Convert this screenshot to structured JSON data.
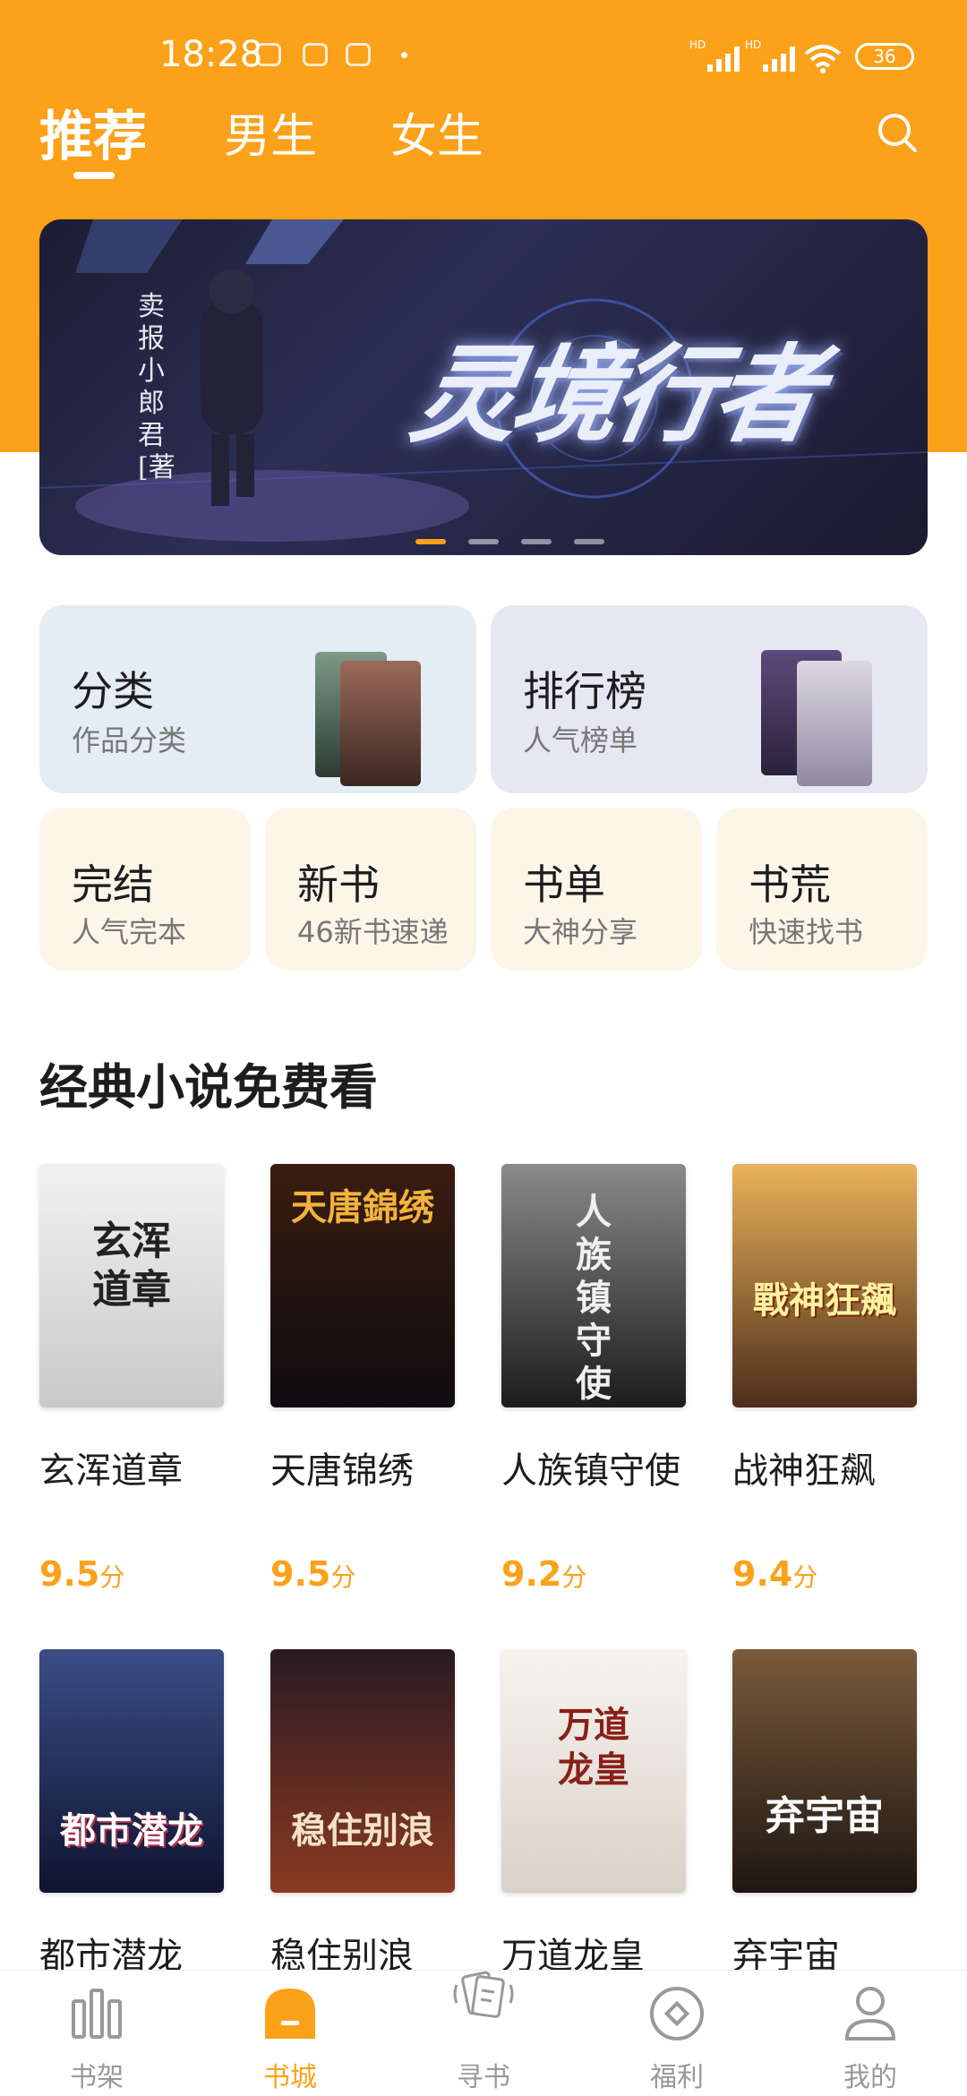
{
  "status_bar": {
    "time": "18:28",
    "battery": "36"
  },
  "tabs": [
    {
      "label": "推荐",
      "active": true
    },
    {
      "label": "男生",
      "active": false
    },
    {
      "label": "女生",
      "active": false
    }
  ],
  "banner": {
    "title": "灵境行者",
    "author": "卖报小郎君[著"
  },
  "cards": {
    "category": {
      "title": "分类",
      "sub": "作品分类"
    },
    "ranking": {
      "title": "排行榜",
      "sub": "人气榜单"
    },
    "small": [
      {
        "title": "完结",
        "sub": "人气完本"
      },
      {
        "title": "新书",
        "sub": "46新书速递"
      },
      {
        "title": "书单",
        "sub": "大神分享"
      },
      {
        "title": "书荒",
        "sub": "快速找书"
      }
    ]
  },
  "section": {
    "title": "经典小说免费看"
  },
  "books": [
    {
      "title": "玄浑道章",
      "score": "9.5",
      "unit": "分",
      "cover_text": "玄浑道章"
    },
    {
      "title": "天唐锦绣",
      "score": "9.5",
      "unit": "分",
      "cover_text": "天唐錦绣"
    },
    {
      "title": "人族镇守使",
      "score": "9.2",
      "unit": "分",
      "cover_text": "人族镇守使"
    },
    {
      "title": "战神狂飙",
      "score": "9.4",
      "unit": "分",
      "cover_text": "戰神狂飆"
    },
    {
      "title": "都市潜龙",
      "cover_text": "都市潜龙"
    },
    {
      "title": "稳住别浪",
      "cover_text": "稳住别浪"
    },
    {
      "title": "万道龙皇",
      "cover_text": "万道龙皇"
    },
    {
      "title": "弃宇宙",
      "cover_text": "弃宇宙"
    }
  ],
  "bottom_nav": [
    {
      "label": "书架",
      "icon": "bookshelf-icon",
      "active": false
    },
    {
      "label": "书城",
      "icon": "bookstore-icon",
      "active": true
    },
    {
      "label": "寻书",
      "icon": "find-book-icon",
      "active": false
    },
    {
      "label": "福利",
      "icon": "welfare-icon",
      "active": false
    },
    {
      "label": "我的",
      "icon": "profile-icon",
      "active": false
    }
  ],
  "colors": {
    "accent": "#fba11a"
  }
}
